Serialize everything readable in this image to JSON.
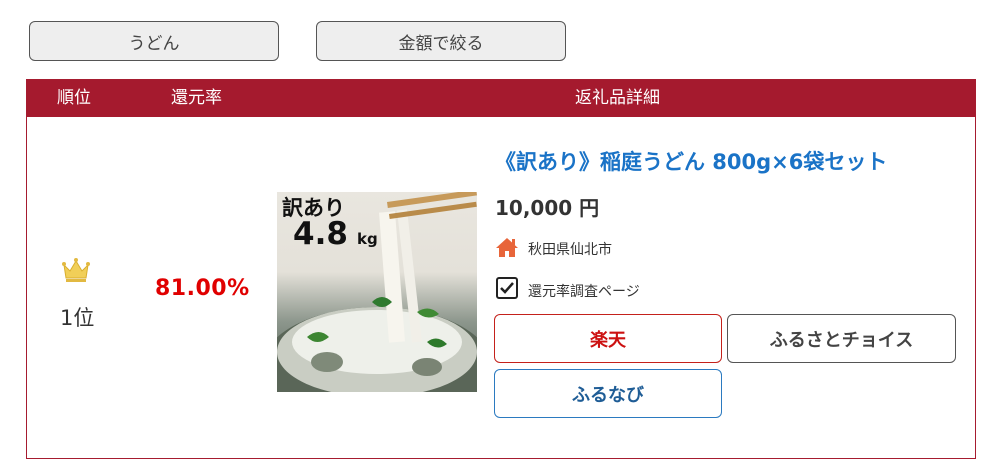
{
  "filters": {
    "keyword_label": "うどん",
    "amount_label": "金額で絞る"
  },
  "table": {
    "headers": {
      "rank": "順位",
      "rate": "還元率",
      "detail": "返礼品詳細"
    },
    "rows": [
      {
        "rank": "1位",
        "rate": "81.00%",
        "image_text": {
          "line1": "訳あり",
          "line2": "4.8",
          "unit": "kg"
        },
        "title": "《訳あり》稲庭うどん 800g×6袋セット",
        "price": "10,000 円",
        "location": "秋田県仙北市",
        "survey_link": "還元率調査ページ",
        "buttons": {
          "rakuten": "楽天",
          "furusato": "ふるさとチョイス",
          "furunavi": "ふるなび"
        }
      }
    ]
  },
  "icons": {
    "crown": "crown-icon",
    "home": "home-icon",
    "check": "checkbox-icon"
  },
  "colors": {
    "header_bg": "#a51a2e",
    "rate": "#e00000",
    "title": "#1a73c7",
    "home_icon": "#e8653a",
    "crown": "#e8c24a"
  }
}
